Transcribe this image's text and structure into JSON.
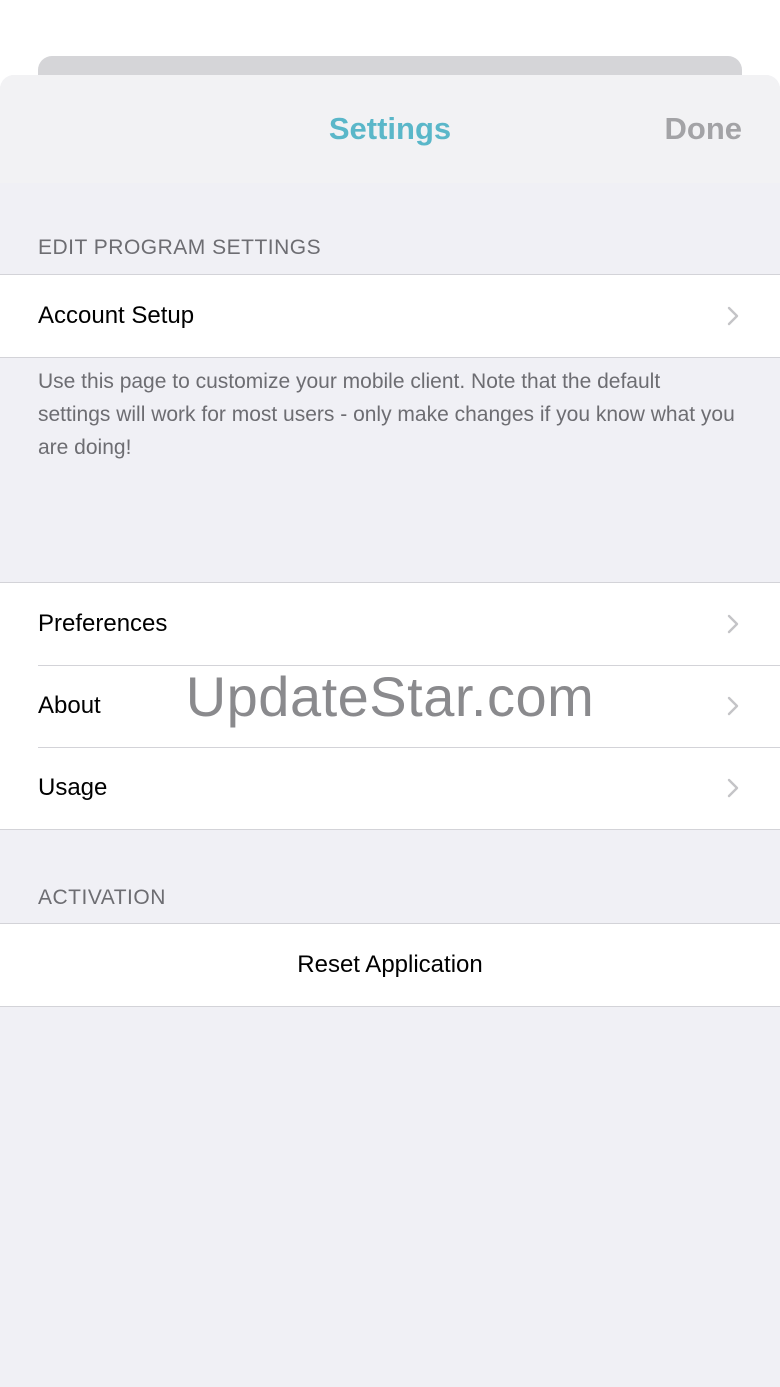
{
  "nav": {
    "title": "Settings",
    "done_label": "Done"
  },
  "sections": {
    "edit_program_settings": {
      "header": "EDIT PROGRAM SETTINGS",
      "items": [
        {
          "label": "Account Setup"
        }
      ],
      "footer": "Use this page to customize your mobile client. Note that the default settings will work for most users - only make changes if you know what you are doing!"
    },
    "general": {
      "items": [
        {
          "label": "Preferences"
        },
        {
          "label": "About"
        },
        {
          "label": "Usage"
        }
      ]
    },
    "activation": {
      "header": "ACTIVATION",
      "items": [
        {
          "label": "Reset Application"
        }
      ]
    }
  },
  "watermark": "UpdateStar.com",
  "colors": {
    "accent": "#5ab7c9",
    "done": "#a3a3a6",
    "background": "#f0f0f5",
    "separator": "#d3d3d8"
  }
}
